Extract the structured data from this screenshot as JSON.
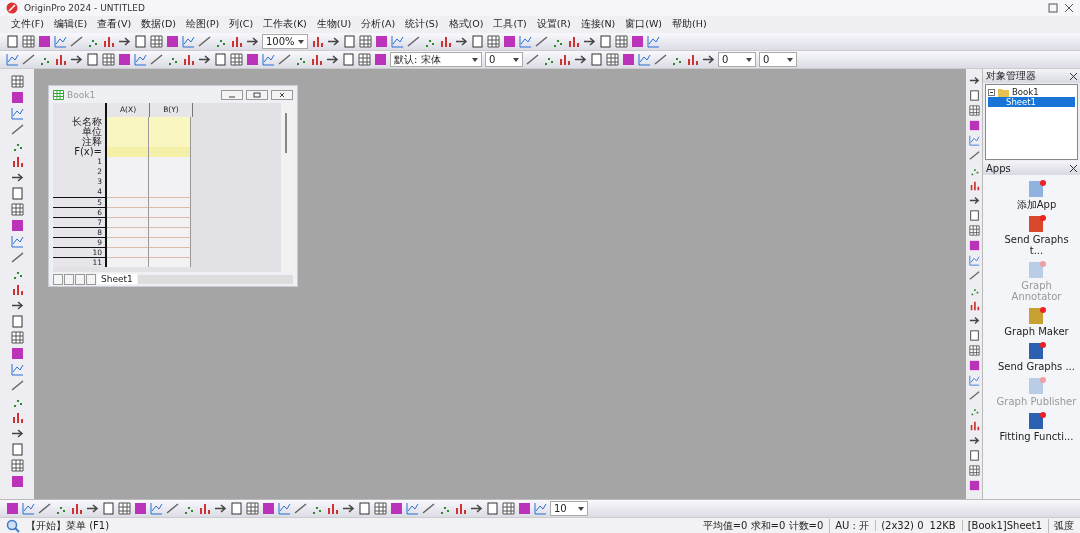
{
  "window": {
    "title": "OriginPro 2024 - UNTITLED"
  },
  "menu": [
    "文件(F)",
    "编辑(E)",
    "查看(V)",
    "数据(D)",
    "绘图(P)",
    "列(C)",
    "工作表(K)",
    "生物(U)",
    "分析(A)",
    "统计(S)",
    "格式(O)",
    "工具(T)",
    "设置(R)",
    "连接(N)",
    "窗口(W)",
    "帮助(H)"
  ],
  "toolbar_1": {
    "zoom": "100%"
  },
  "toolbar_2": {
    "font": "默认: 宋体",
    "font_size": "0",
    "value_1": "0",
    "value_2": "0"
  },
  "workbook": {
    "title": "Book1",
    "columns": [
      "A(X)",
      "B(Y)"
    ],
    "header_rows": [
      "长名称",
      "单位",
      "注释",
      "F(x)="
    ],
    "rows": [
      "1",
      "2",
      "3",
      "4",
      "5",
      "6",
      "7",
      "8",
      "9",
      "10",
      "11"
    ],
    "sheet_tabs": [
      {
        "label": "Sheet1",
        "selected": true
      }
    ]
  },
  "object_manager": {
    "title": "对象管理器",
    "tree": [
      {
        "label": "Book1",
        "expanded": true,
        "children": [
          {
            "label": "Sheet1",
            "selected": true
          }
        ]
      }
    ]
  },
  "apps": {
    "title": "Apps",
    "items": [
      {
        "label": "添加App",
        "disabled": false
      },
      {
        "label": "Send Graphs t...",
        "disabled": false
      },
      {
        "label": "Graph Annotator",
        "disabled": true
      },
      {
        "label": "Graph Maker",
        "disabled": false
      },
      {
        "label": "Send Graphs ...",
        "disabled": false
      },
      {
        "label": "Graph Publisher",
        "disabled": true
      },
      {
        "label": "Fitting Functi...",
        "disabled": false
      }
    ]
  },
  "bottom_toolbar": {
    "font_size": "10"
  },
  "status_bar": {
    "hint": "【开始】菜单 (F1)",
    "stats": "平均值=0 求和=0 计数=0",
    "au": "AU : 开",
    "cells": "(2x32) 0",
    "size": "12KB",
    "sheet": "[Book1]Sheet1",
    "angle": "弧度"
  }
}
